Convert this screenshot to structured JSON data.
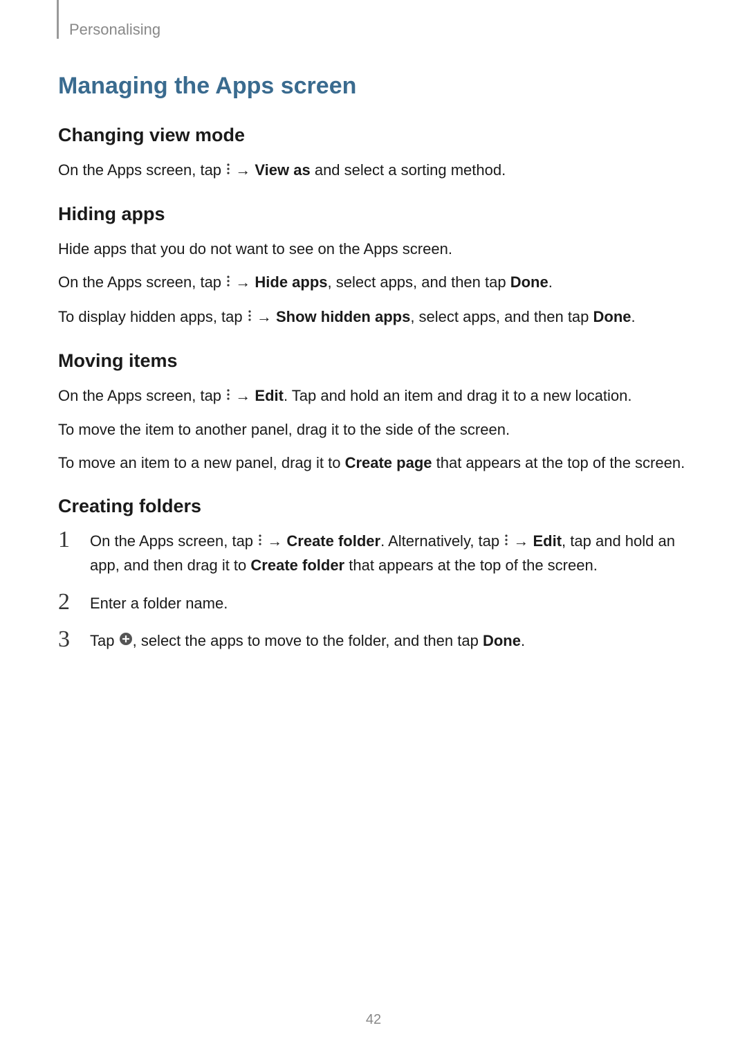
{
  "header": {
    "section_name": "Personalising"
  },
  "main_heading": "Managing the Apps screen",
  "section1": {
    "heading": "Changing view mode",
    "p1_a": "On the Apps screen, tap ",
    "p1_arrow": " → ",
    "p1_bold": "View as",
    "p1_b": " and select a sorting method."
  },
  "section2": {
    "heading": "Hiding apps",
    "p1": "Hide apps that you do not want to see on the Apps screen.",
    "p2_a": "On the Apps screen, tap ",
    "p2_arrow": " → ",
    "p2_bold": "Hide apps",
    "p2_b": ", select apps, and then tap ",
    "p2_bold2": "Done",
    "p2_c": ".",
    "p3_a": "To display hidden apps, tap ",
    "p3_arrow": " → ",
    "p3_bold": "Show hidden apps",
    "p3_b": ", select apps, and then tap ",
    "p3_bold2": "Done",
    "p3_c": "."
  },
  "section3": {
    "heading": "Moving items",
    "p1_a": "On the Apps screen, tap ",
    "p1_arrow": " → ",
    "p1_bold": "Edit",
    "p1_b": ". Tap and hold an item and drag it to a new location.",
    "p2": "To move the item to another panel, drag it to the side of the screen.",
    "p3_a": "To move an item to a new panel, drag it to ",
    "p3_bold": "Create page",
    "p3_b": " that appears at the top of the screen."
  },
  "section4": {
    "heading": "Creating folders",
    "item1": {
      "num": "1",
      "a": "On the Apps screen, tap ",
      "arrow1": " → ",
      "bold1": "Create folder",
      "b": ". Alternatively, tap ",
      "arrow2": " → ",
      "bold2": "Edit",
      "c": ", tap and hold an app, and then drag it to ",
      "bold3": "Create folder",
      "d": " that appears at the top of the screen."
    },
    "item2": {
      "num": "2",
      "text": "Enter a folder name."
    },
    "item3": {
      "num": "3",
      "a": "Tap ",
      "b": ", select the apps to move to the folder, and then tap ",
      "bold": "Done",
      "c": "."
    }
  },
  "page_number": "42"
}
